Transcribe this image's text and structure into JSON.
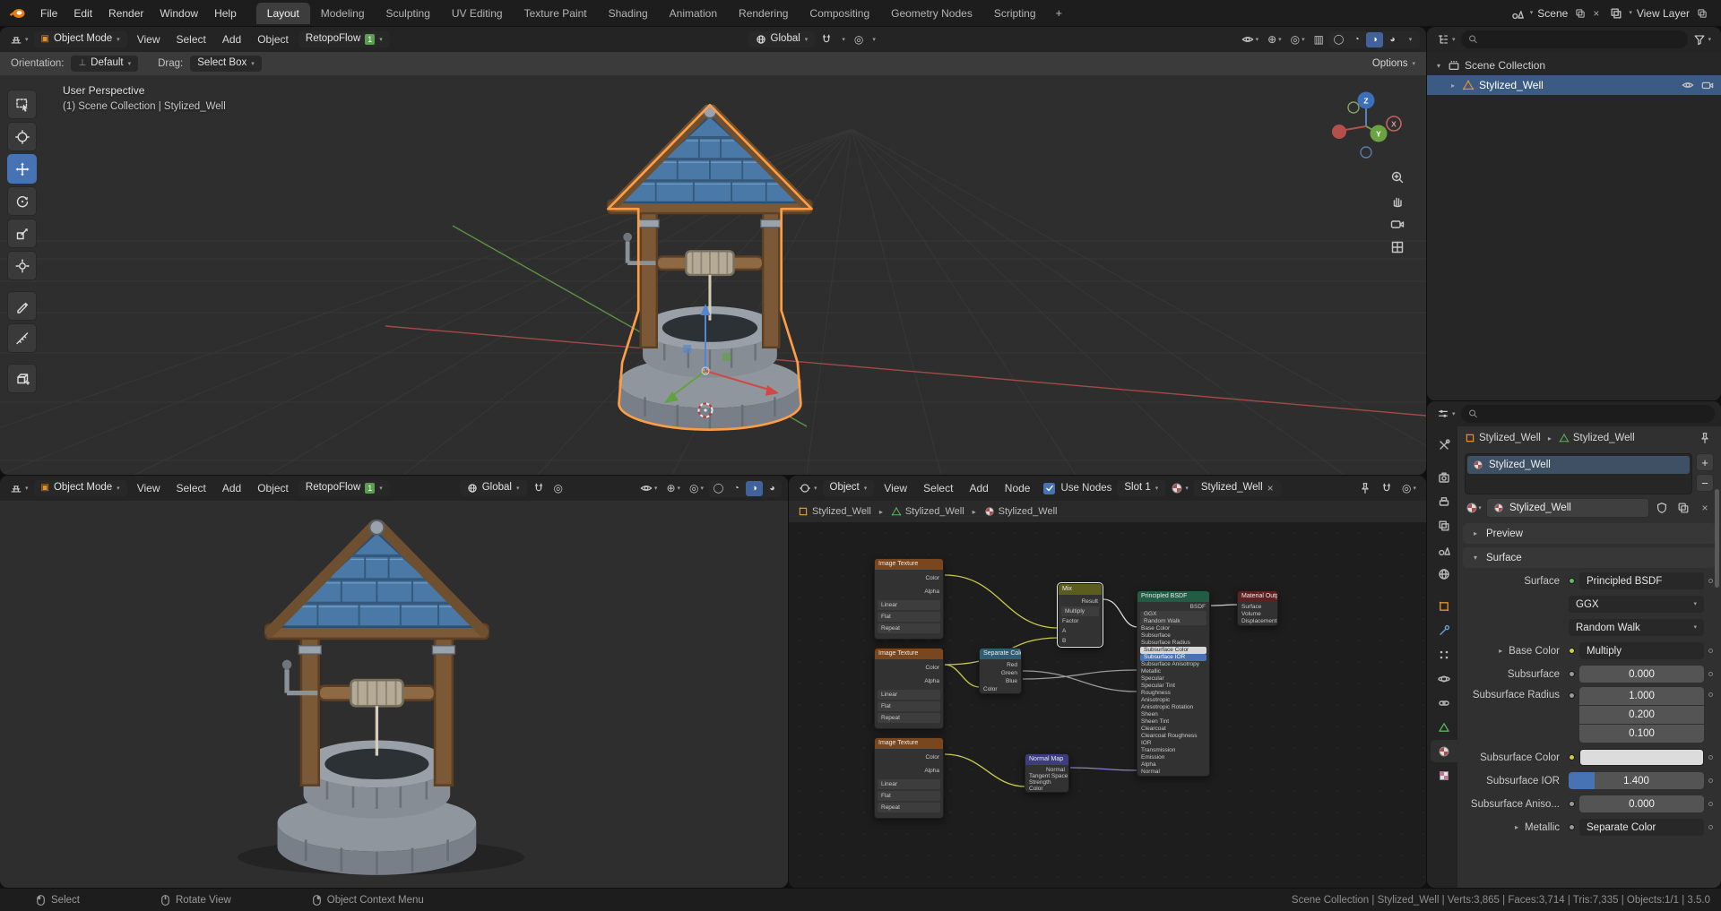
{
  "topbar": {
    "menus": [
      "File",
      "Edit",
      "Render",
      "Window",
      "Help"
    ],
    "workspaces": [
      "Layout",
      "Modeling",
      "Sculpting",
      "UV Editing",
      "Texture Paint",
      "Shading",
      "Animation",
      "Rendering",
      "Compositing",
      "Geometry Nodes",
      "Scripting"
    ],
    "new_workspace_label": "+",
    "scene_label": "Scene",
    "view_layer_label": "View Layer"
  },
  "viewport": {
    "mode": "Object Mode",
    "menus": [
      "View",
      "Select",
      "Add",
      "Object"
    ],
    "retopoflow_label": "RetopoFlow",
    "retopoflow_badge": "1",
    "orientation": "Global",
    "options_label": "Options",
    "tool_settings": {
      "orientation_label": "Orientation:",
      "orientation_value": "Default",
      "drag_label": "Drag:",
      "drag_value": "Select Box"
    },
    "overlay_line1": "User Perspective",
    "overlay_line2": "(1) Scene Collection | Stylized_Well",
    "axes": {
      "z": "Z",
      "y": "Y",
      "x": "X"
    }
  },
  "viewport2": {
    "mode": "Object Mode",
    "menus": [
      "View",
      "Select",
      "Add",
      "Object"
    ],
    "retopoflow_label": "RetopoFlow",
    "retopoflow_badge": "1",
    "orientation": "Global"
  },
  "shader": {
    "type": "Object",
    "menus": [
      "View",
      "Select",
      "Add",
      "Node"
    ],
    "use_nodes_label": "Use Nodes",
    "slot_label": "Slot 1",
    "material_name": "Stylized_Well",
    "breadcrumb": [
      "Stylized_Well",
      "Stylized_Well",
      "Stylized_Well"
    ],
    "nodes": {
      "tex1": {
        "title": "Image Texture",
        "rows": [
          "Color",
          "Alpha",
          "Linear",
          "Flat",
          "Repeat"
        ]
      },
      "tex2": {
        "title": "Image Texture",
        "rows": [
          "Color",
          "Alpha",
          "Linear",
          "Flat",
          "Repeat"
        ]
      },
      "tex3": {
        "title": "Image Texture",
        "rows": [
          "Color",
          "Alpha",
          "Linear",
          "Flat",
          "Repeat"
        ]
      },
      "separate": {
        "title": "Separate Color",
        "rows": [
          "Red",
          "Green",
          "Blue",
          "Color"
        ]
      },
      "mix": {
        "title": "Mix",
        "rows": [
          "Result",
          "Multiply",
          "Factor",
          "A",
          "B"
        ]
      },
      "bsdf": {
        "title": "Principled BSDF",
        "rows": [
          "BSDF",
          "GGX",
          "Random Walk",
          "Base Color",
          "Subsurface",
          "Subsurface Radius",
          "Subsurface Color",
          "Subsurface IOR",
          "Subsurface Anisotropy",
          "Metallic",
          "Specular",
          "Specular Tint",
          "Roughness",
          "Anisotropic",
          "Anisotropic Rotation",
          "Sheen",
          "Sheen Tint",
          "Clearcoat",
          "Clearcoat Roughness",
          "IOR",
          "Transmission",
          "Emission",
          "Alpha",
          "Normal"
        ]
      },
      "normalmap": {
        "title": "Normal Map",
        "rows": [
          "Normal",
          "Tangent Space",
          "Strength",
          "Color"
        ]
      },
      "output": {
        "title": "Material Output",
        "rows": [
          "Surface",
          "Volume",
          "Displacement"
        ]
      }
    }
  },
  "outliner": {
    "collection_label": "Scene Collection",
    "object_label": "Stylized_Well"
  },
  "properties": {
    "breadcrumb_object": "Stylized_Well",
    "breadcrumb_data": "Stylized_Well",
    "slot_name": "Stylized_Well",
    "material_name": "Stylized_Well",
    "preview_panel": "Preview",
    "surface_panel": "Surface",
    "surface_label": "Surface",
    "surface_value": "Principled BSDF",
    "distribution_value": "GGX",
    "sss_method_value": "Random Walk",
    "base_color_label": "Base Color",
    "base_color_value": "Multiply",
    "subsurface_label": "Subsurface",
    "subsurface_value": "0.000",
    "radius_label": "Subsurface Radius",
    "radius_values": [
      "1.000",
      "0.200",
      "0.100"
    ],
    "sss_color_label": "Subsurface Color",
    "ior_label": "Subsurface IOR",
    "ior_value": "1.400",
    "aniso_label": "Subsurface Aniso...",
    "aniso_value": "0.000",
    "metallic_label": "Metallic",
    "metallic_value": "Separate Color"
  },
  "statusbar": {
    "hint_select": "Select",
    "hint_rotate": "Rotate View",
    "hint_context": "Object Context Menu",
    "stats": "Scene Collection | Stylized_Well | Verts:3,865 | Faces:3,714 | Tris:7,335 | Objects:1/1 | 3.5.0"
  },
  "colors": {
    "accent": "#4772b3",
    "selection_outline": "#ff9d45",
    "axis_x": "#b4403f",
    "axis_y": "#6ba343",
    "axis_z": "#3b6fb8"
  }
}
